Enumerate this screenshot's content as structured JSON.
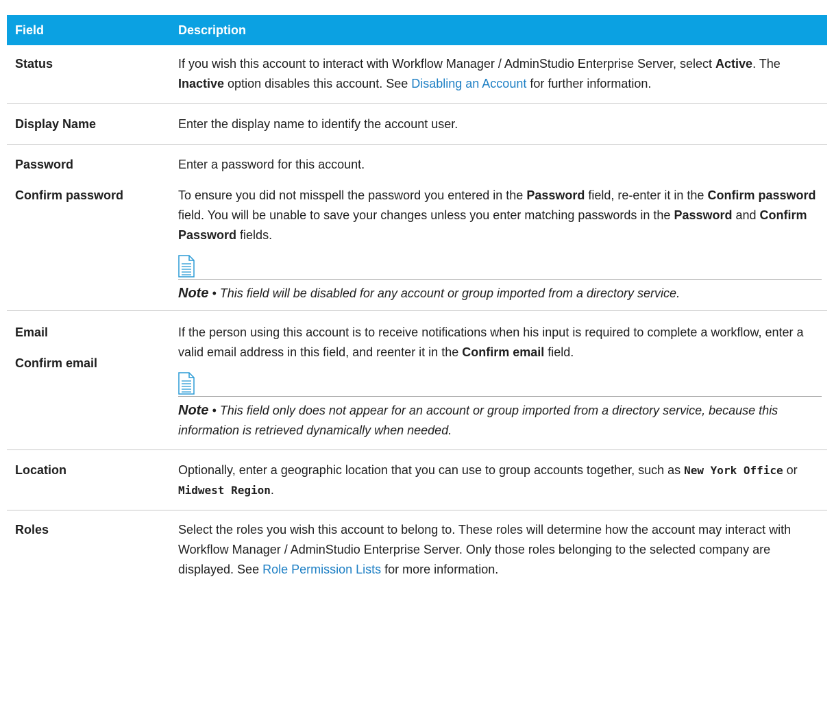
{
  "header": {
    "field": "Field",
    "description": "Description"
  },
  "rows": {
    "status": {
      "field": "Status",
      "d1": "If you wish this account to interact with Workflow Manager / AdminStudio Enterprise Server, select ",
      "b1": "Active",
      "d2": ". The ",
      "b2": "Inactive",
      "d3": " option disables this account. See ",
      "link": "Disabling an Account",
      "d4": " for further information."
    },
    "display_name": {
      "field": "Display Name",
      "d1": "Enter the display name to identify the account user."
    },
    "password": {
      "field1": "Password",
      "field2": "Confirm password",
      "p1": "Enter a password for this account.",
      "d1": "To ensure you did not misspell the password you entered in the ",
      "b1": "Password",
      "d2": " field, re-enter it in the ",
      "b2": "Confirm password",
      "d3": " field. You will be unable to save your changes unless you enter matching passwords in the ",
      "b3": "Password",
      "d4": " and ",
      "b4": "Confirm Password",
      "d5": " fields.",
      "note_label": "Note",
      "note_sep": " • ",
      "note_text": "This field will be disabled for any account or group imported from a directory service."
    },
    "email": {
      "field1": "Email",
      "field2": "Confirm email",
      "d1": "If the person using this account is to receive notifications when his input is required to complete a workflow, enter a valid email address in this field, and reenter it in the ",
      "b1": "Confirm email",
      "d2": " field.",
      "note_label": "Note",
      "note_sep": " • ",
      "note_text": "This field only does not appear for an account or group imported from a directory service, because this information is retrieved dynamically when needed."
    },
    "location": {
      "field": "Location",
      "d1": "Optionally, enter a geographic location that you can use to group accounts together, such as ",
      "m1": "New York Office",
      "d2": " or ",
      "m2": "Midwest Region",
      "d3": "."
    },
    "roles": {
      "field": "Roles",
      "d1": "Select the roles you wish this account to belong to. These roles will determine how the account may interact with Workflow Manager / AdminStudio Enterprise Server. Only those roles belonging to the selected company are displayed. See ",
      "link": "Role Permission Lists",
      "d2": " for more information."
    }
  },
  "colors": {
    "header_bg": "#0ba1e2",
    "link": "#1d7fc4",
    "note_icon": "#2b9bd6"
  },
  "icons": {
    "note": "note-document-icon"
  }
}
